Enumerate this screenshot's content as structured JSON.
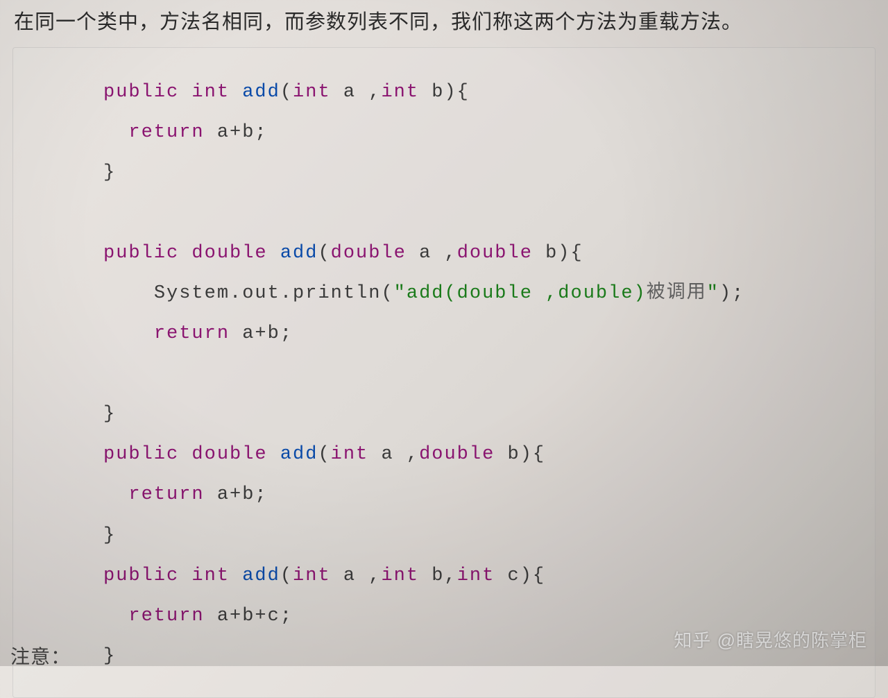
{
  "header": {
    "text": "在同一个类中，方法名相同，而参数列表不同，我们称这两个方法为重载方法。"
  },
  "code": {
    "lines": [
      {
        "indent": 0,
        "segments": [
          {
            "cls": "kw-modifier",
            "t": "public"
          },
          {
            "cls": "plain",
            "t": " "
          },
          {
            "cls": "kw-type",
            "t": "int"
          },
          {
            "cls": "plain",
            "t": " "
          },
          {
            "cls": "method-name",
            "t": "add"
          },
          {
            "cls": "plain",
            "t": "("
          },
          {
            "cls": "kw-type",
            "t": "int"
          },
          {
            "cls": "plain",
            "t": " a ,"
          },
          {
            "cls": "kw-type",
            "t": "int"
          },
          {
            "cls": "plain",
            "t": " b){"
          }
        ]
      },
      {
        "indent": 1,
        "segments": [
          {
            "cls": "kw-return",
            "t": "return"
          },
          {
            "cls": "plain",
            "t": " a+b;"
          }
        ]
      },
      {
        "indent": 0,
        "segments": [
          {
            "cls": "plain",
            "t": "}"
          }
        ]
      },
      {
        "indent": 0,
        "segments": [
          {
            "cls": "plain",
            "t": ""
          }
        ]
      },
      {
        "indent": 0,
        "segments": [
          {
            "cls": "kw-modifier",
            "t": "public"
          },
          {
            "cls": "plain",
            "t": " "
          },
          {
            "cls": "kw-type",
            "t": "double"
          },
          {
            "cls": "plain",
            "t": " "
          },
          {
            "cls": "method-name",
            "t": "add"
          },
          {
            "cls": "plain",
            "t": "("
          },
          {
            "cls": "kw-type",
            "t": "double"
          },
          {
            "cls": "plain",
            "t": " a ,"
          },
          {
            "cls": "kw-type",
            "t": "double"
          },
          {
            "cls": "plain",
            "t": " b){"
          }
        ]
      },
      {
        "indent": 2,
        "segments": [
          {
            "cls": "plain",
            "t": "System.out.println("
          },
          {
            "cls": "string-lit",
            "t": "\"add(double ,double)"
          },
          {
            "cls": "chinese-in-string",
            "t": "被调用"
          },
          {
            "cls": "string-lit",
            "t": "\""
          },
          {
            "cls": "plain",
            "t": ");"
          }
        ]
      },
      {
        "indent": 2,
        "segments": [
          {
            "cls": "kw-return",
            "t": "return"
          },
          {
            "cls": "plain",
            "t": " a+b;"
          }
        ]
      },
      {
        "indent": 0,
        "segments": [
          {
            "cls": "plain",
            "t": ""
          }
        ]
      },
      {
        "indent": 0,
        "segments": [
          {
            "cls": "plain",
            "t": "}"
          }
        ]
      },
      {
        "indent": 0,
        "segments": [
          {
            "cls": "kw-modifier",
            "t": "public"
          },
          {
            "cls": "plain",
            "t": " "
          },
          {
            "cls": "kw-type",
            "t": "double"
          },
          {
            "cls": "plain",
            "t": " "
          },
          {
            "cls": "method-name",
            "t": "add"
          },
          {
            "cls": "plain",
            "t": "("
          },
          {
            "cls": "kw-type",
            "t": "int"
          },
          {
            "cls": "plain",
            "t": " a ,"
          },
          {
            "cls": "kw-type",
            "t": "double"
          },
          {
            "cls": "plain",
            "t": " b){"
          }
        ]
      },
      {
        "indent": 1,
        "segments": [
          {
            "cls": "kw-return",
            "t": "return"
          },
          {
            "cls": "plain",
            "t": " a+b;"
          }
        ]
      },
      {
        "indent": 0,
        "segments": [
          {
            "cls": "plain",
            "t": "}"
          }
        ]
      },
      {
        "indent": 0,
        "segments": [
          {
            "cls": "kw-modifier",
            "t": "public"
          },
          {
            "cls": "plain",
            "t": " "
          },
          {
            "cls": "kw-type",
            "t": "int"
          },
          {
            "cls": "plain",
            "t": " "
          },
          {
            "cls": "method-name",
            "t": "add"
          },
          {
            "cls": "plain",
            "t": "("
          },
          {
            "cls": "kw-type",
            "t": "int"
          },
          {
            "cls": "plain",
            "t": " a ,"
          },
          {
            "cls": "kw-type",
            "t": "int"
          },
          {
            "cls": "plain",
            "t": " b,"
          },
          {
            "cls": "kw-type",
            "t": "int"
          },
          {
            "cls": "plain",
            "t": " c){"
          }
        ]
      },
      {
        "indent": 1,
        "segments": [
          {
            "cls": "kw-return",
            "t": "return"
          },
          {
            "cls": "plain",
            "t": " a+b+c;"
          }
        ]
      },
      {
        "indent": 0,
        "segments": [
          {
            "cls": "plain",
            "t": "}"
          }
        ]
      }
    ]
  },
  "watermark": {
    "text": "知乎 @瞎晃悠的陈掌柜"
  },
  "footer": {
    "text": "注意："
  }
}
